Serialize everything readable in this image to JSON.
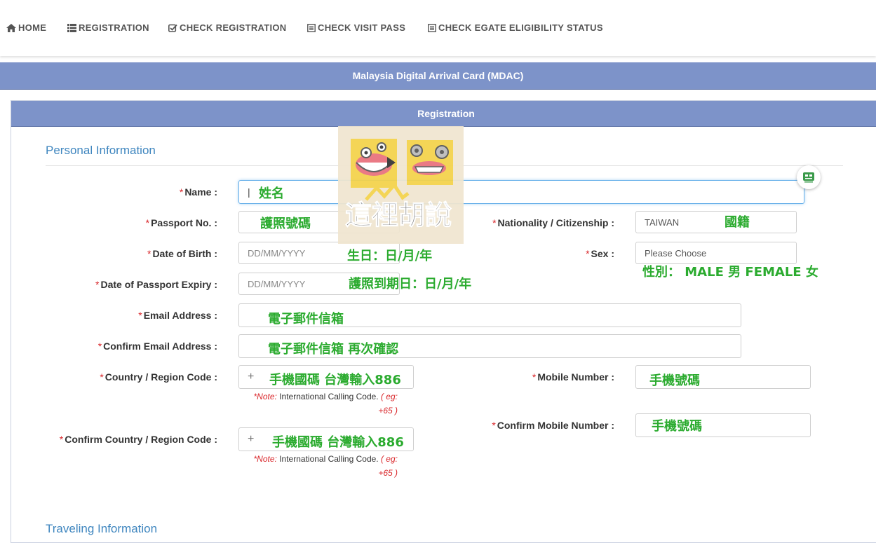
{
  "nav": {
    "home": "HOME",
    "registration": "REGISTRATION",
    "check_registration": "CHECK REGISTRATION",
    "check_visit_pass": "CHECK VISIT PASS",
    "check_egate": "CHECK EGATE ELIGIBILITY STATUS"
  },
  "page": {
    "band_title": "Malaysia Digital Arrival Card (MDAC)",
    "panel_title": "Registration",
    "section_personal": "Personal Information",
    "section_travel": "Traveling Information"
  },
  "form": {
    "name_label": "Name :",
    "passport_label": "Passport No. :",
    "nationality_label": "Nationality / Citizenship :",
    "nationality_value": "TAIWAN",
    "dob_label": "Date of Birth :",
    "dob_placeholder": "DD/MM/YYYY",
    "sex_label": "Sex :",
    "sex_value": "Please Choose",
    "expiry_label": "Date of Passport Expiry :",
    "expiry_placeholder": "DD/MM/YYYY",
    "email_label": "Email Address :",
    "confirm_email_label": "Confirm Email Address :",
    "country_code_label": "Country / Region Code :",
    "country_code_prefix": "+",
    "mobile_label": "Mobile Number :",
    "confirm_country_code_label": "Confirm Country / Region Code :",
    "confirm_mobile_label": "Confirm Mobile Number :",
    "note_label": "*Note:",
    "note_text": " International Calling Code.",
    "note_eg": " ( eg:",
    "note_eg2": "+65 )"
  },
  "annotations": {
    "name": "姓名",
    "passport": "護照號碼",
    "nationality": "國籍",
    "dob": "生日：日/月/年",
    "sex": "性別： MALE 男  FEMALE 女",
    "expiry": "護照到期日：日/月/年",
    "email": "電子郵件信箱",
    "confirm_email": "電子郵件信箱  再次確認",
    "country_code": "手機國碼 台灣輸入886",
    "mobile": "手機號碼",
    "confirm_country_code": "手機國碼 台灣輸入886",
    "confirm_mobile": "手機號碼"
  },
  "sticker": {
    "text": "這裡胡說"
  },
  "colors": {
    "header_band": "#7d93c9",
    "section_title": "#3f86bf",
    "annotation_green": "#2bab2f",
    "required_red": "#d9262a"
  }
}
